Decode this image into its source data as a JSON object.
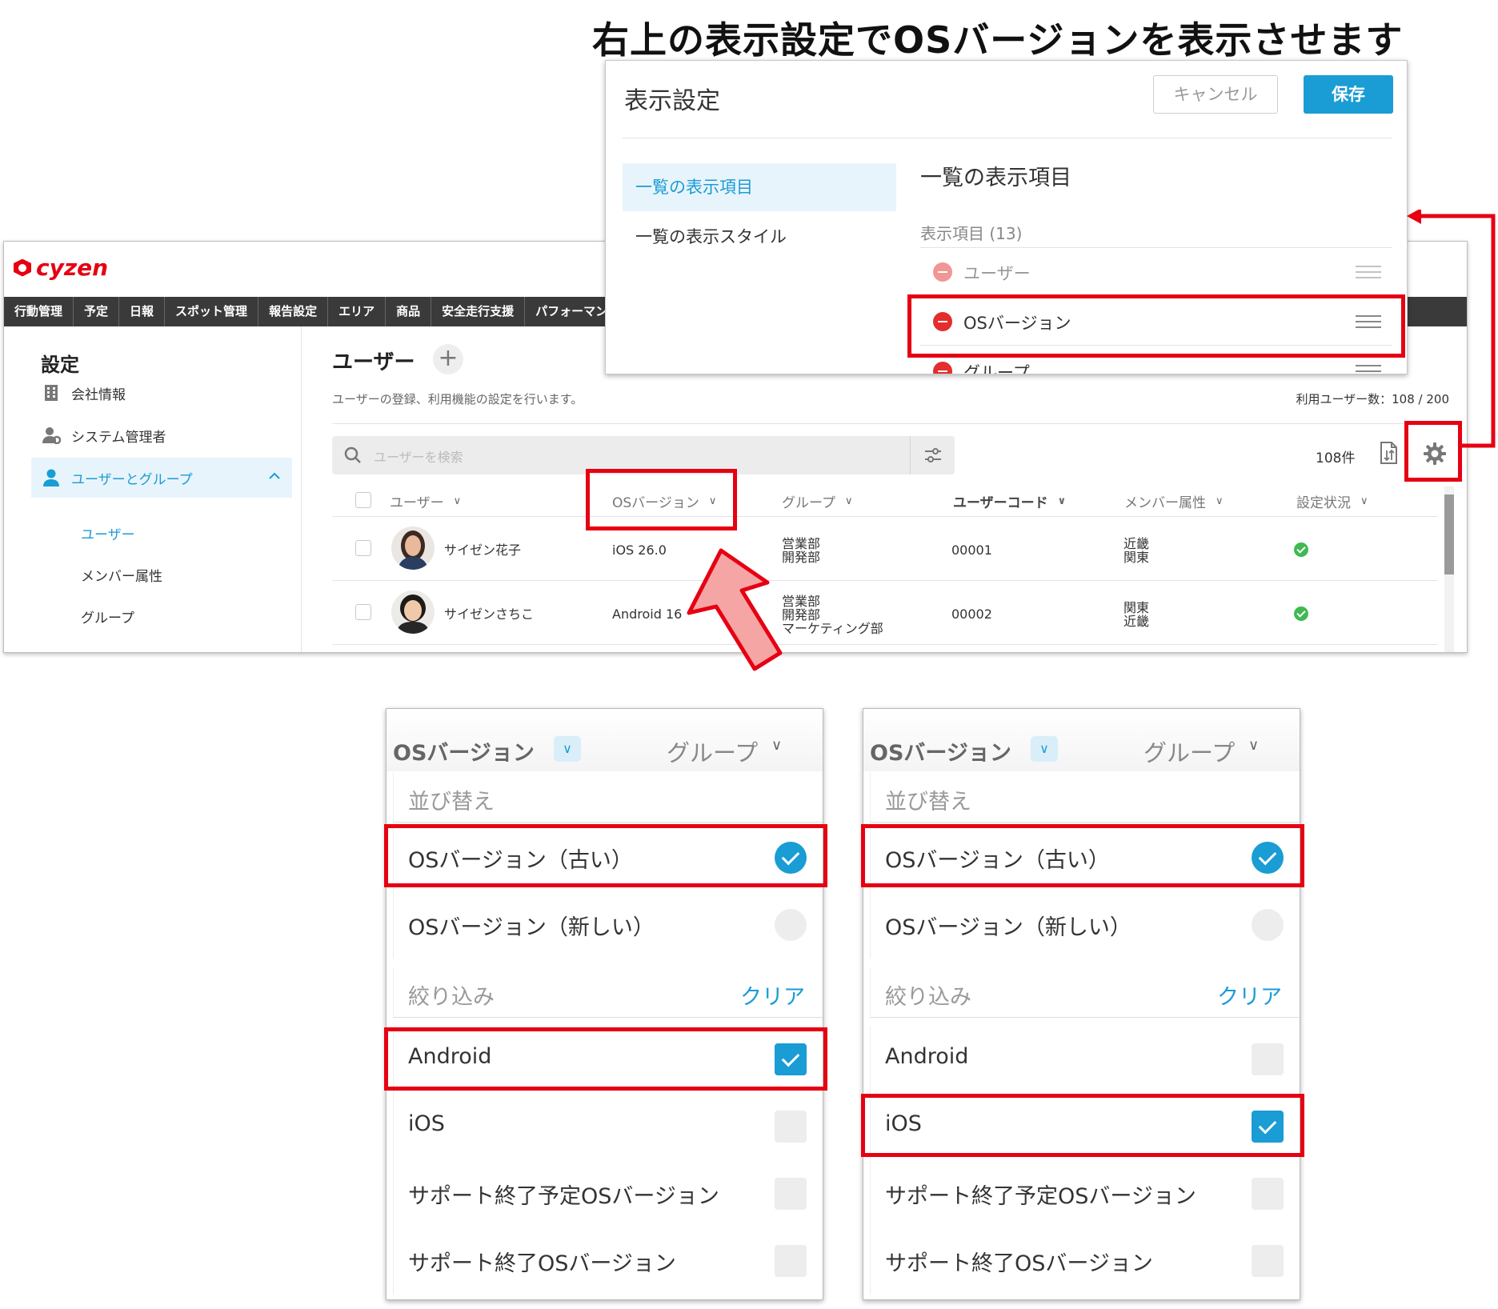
{
  "headline": "右上の表示設定でOSバージョンを表示させます",
  "app": {
    "logo": "cyzen",
    "nav": [
      "行動管理",
      "予定",
      "日報",
      "スポット管理",
      "報告設定",
      "エリア",
      "商品",
      "安全走行支援",
      "パフォーマンス"
    ],
    "sidebar": {
      "title": "設定",
      "items": [
        {
          "label": "会社情報",
          "icon": "building-icon"
        },
        {
          "label": "システム管理者",
          "icon": "admin-user-icon"
        },
        {
          "label": "ユーザーとグループ",
          "icon": "user-icon"
        }
      ],
      "sub_items": [
        "ユーザー",
        "メンバー属性",
        "グループ"
      ]
    },
    "main": {
      "title": "ユーザー",
      "add_label": "+",
      "description": "ユーザーの登録、利用機能の設定を行います。",
      "user_count": "利用ユーザー数：108 / 200",
      "search_placeholder": "ユーザーを検索",
      "record_count": "108件",
      "columns": [
        "ユーザー",
        "OSバージョン",
        "グループ",
        "ユーザーコード",
        "メンバー属性",
        "設定状況"
      ],
      "rows": [
        {
          "name": "サイゼン花子",
          "os": "iOS 26.0",
          "groups": [
            "営業部",
            "開発部"
          ],
          "code": "00001",
          "attributes": [
            "近畿",
            "関東"
          ],
          "status": "ok"
        },
        {
          "name": "サイゼンさちこ",
          "os": "Android 16",
          "groups": [
            "営業部",
            "開発部",
            "マーケティング部"
          ],
          "code": "00002",
          "attributes": [
            "関東",
            "近畿"
          ],
          "status": "ok"
        }
      ]
    }
  },
  "modal": {
    "title": "表示設定",
    "cancel_label": "キャンセル",
    "save_label": "保存",
    "nav": [
      "一覧の表示項目",
      "一覧の表示スタイル"
    ],
    "panel_title": "一覧の表示項目",
    "items_label": "表示項目 (13)",
    "items": [
      "ユーザー",
      "OSバージョン",
      "グループ"
    ]
  },
  "panels": [
    {
      "header_os": "OSバージョン",
      "header_group": "グループ",
      "sort_label": "並び替え",
      "sort_options": [
        {
          "label": "OSバージョン（古い）",
          "selected": true
        },
        {
          "label": "OSバージョン（新しい）",
          "selected": false
        }
      ],
      "filter_label": "絞り込み",
      "clear_label": "クリア",
      "filter_options": [
        {
          "label": "Android",
          "checked": true
        },
        {
          "label": "iOS",
          "checked": false
        },
        {
          "label": "サポート終了予定OSバージョン",
          "checked": false
        },
        {
          "label": "サポート終了OSバージョン",
          "checked": false
        }
      ]
    },
    {
      "header_os": "OSバージョン",
      "header_group": "グループ",
      "sort_label": "並び替え",
      "sort_options": [
        {
          "label": "OSバージョン（古い）",
          "selected": true
        },
        {
          "label": "OSバージョン（新しい）",
          "selected": false
        }
      ],
      "filter_label": "絞り込み",
      "clear_label": "クリア",
      "filter_options": [
        {
          "label": "Android",
          "checked": false
        },
        {
          "label": "iOS",
          "checked": true
        },
        {
          "label": "サポート終了予定OSバージョン",
          "checked": false
        },
        {
          "label": "サポート終了OSバージョン",
          "checked": false
        }
      ]
    }
  ],
  "colors": {
    "accent": "#1a9cd4",
    "annotation_red": "#e60012",
    "brand": "#e60012",
    "nav_bg": "#3a3a3a",
    "status_ok": "#3fba52"
  }
}
